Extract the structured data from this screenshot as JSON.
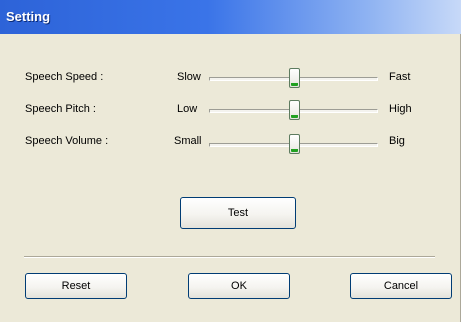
{
  "window": {
    "title": "Setting"
  },
  "settings": [
    {
      "label": "Speech Speed :",
      "min_label": "Slow",
      "max_label": "Fast",
      "value": 0.5
    },
    {
      "label": "Speech Pitch :",
      "min_label": "Low",
      "max_label": "High",
      "value": 0.5
    },
    {
      "label": "Speech Volume :",
      "min_label": "Small",
      "max_label": "Big",
      "value": 0.5
    }
  ],
  "buttons": {
    "test": "Test",
    "reset": "Reset",
    "ok": "OK",
    "cancel": "Cancel"
  },
  "colors": {
    "title_bar": "#2d63d8",
    "dialog_bg": "#ece9d8",
    "button_border": "#003c74",
    "slider_thumb_accent": "#21a121"
  }
}
